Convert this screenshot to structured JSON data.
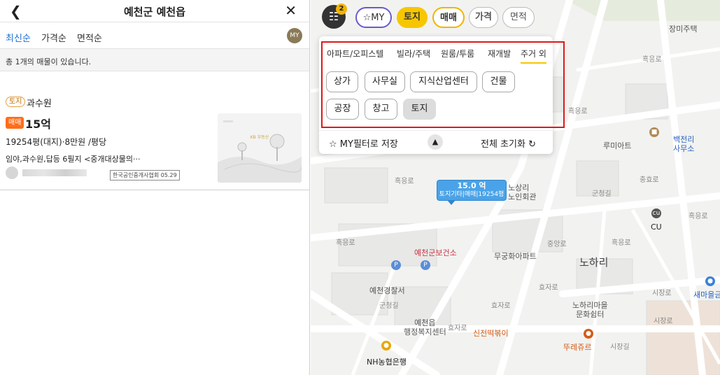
{
  "header": {
    "title": "예천군 예천읍",
    "back_icon": "chevron-left-icon",
    "close_icon": "close-icon"
  },
  "sort": {
    "items": [
      "최신순",
      "가격순",
      "면적순"
    ],
    "active": 0,
    "my_icon": "MY"
  },
  "count_text": "총 1개의 매물이 있습니다.",
  "listing": {
    "type_tag": "토지",
    "use": "과수원",
    "deal_tag": "매매",
    "price": "15억",
    "area": "19254평(대지)·8만원 /평당",
    "desc": "임야,과수원,답등 6필지 <중개대상물의···",
    "source": "한국공인중개사협회 05.29",
    "thumb_logo": "KB 부동산"
  },
  "map": {
    "filter_badge": "2",
    "chips": {
      "my": "MY",
      "land": "토지",
      "sale": "매매",
      "price": "가격",
      "area": "면적"
    },
    "tabs": [
      "아파트/오피스텔",
      "빌라/주택",
      "원룸/투룸",
      "재개발",
      "주거 외"
    ],
    "active_tab": 4,
    "options": [
      "상가",
      "사무실",
      "지식산업센터",
      "건물",
      "공장",
      "창고",
      "토지"
    ],
    "selected_option": "토지",
    "save_label": "MY필터로 저장",
    "reset_label": "전체 초기화",
    "marker": {
      "price": "15.0 억",
      "detail": "토지기타|매매|19254평"
    },
    "labels": {
      "jangmi": "장미주택",
      "baekjeon": "백전리\n사무소",
      "lumi": "루미아트",
      "noin": "노상리\n노인회관",
      "cu": "CU",
      "bogeon": "예천군보건소",
      "mugung": "무궁화아파트",
      "noha": "노하리",
      "police": "예천경찰서",
      "semaeul": "새마을금고",
      "nohamaul": "노하리마을\n문화쉼터",
      "bokji": "예천읍\n행정복지센터",
      "shinjeon": "신전떡볶이",
      "nh": "NH농협은행",
      "tous": "뚜레쥬르",
      "roads": [
        "흑응로",
        "흑응로",
        "흑응로",
        "흑응로",
        "흑응로",
        "흑응로",
        "군청길",
        "군청길",
        "효자로",
        "효자로",
        "효자로",
        "시장로",
        "시장로",
        "시장길",
        "충효로",
        "중앙로"
      ]
    }
  }
}
